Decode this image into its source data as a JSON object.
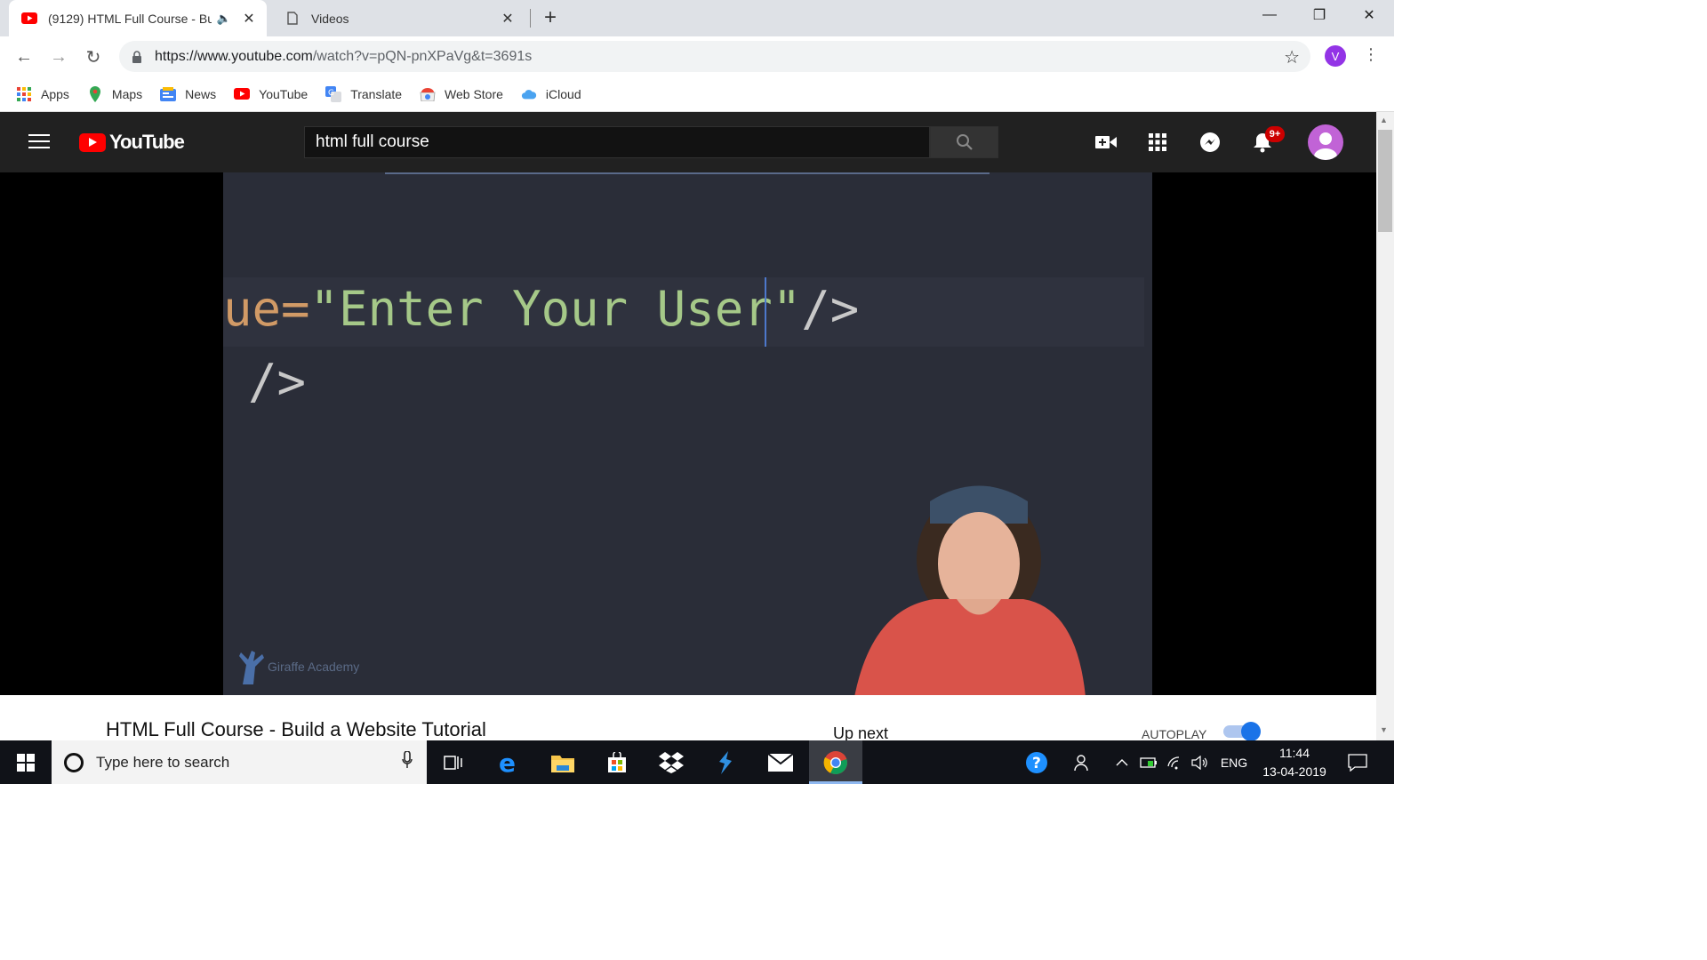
{
  "browser": {
    "tabs": [
      {
        "title": "(9129) HTML Full Course - Bu",
        "active": true,
        "audio": true
      },
      {
        "title": "Videos",
        "active": false
      }
    ],
    "new_tab": "+",
    "window_controls": {
      "minimize": "—",
      "restore": "❐",
      "close": "✕"
    },
    "url_host": "https://www.youtube.com",
    "url_path": "/watch?v=pQN-pnXPaVg&t=3691s",
    "profile_initial": "V",
    "bookmarks": [
      {
        "label": "Apps",
        "icon": "apps-grid-icon"
      },
      {
        "label": "Maps",
        "icon": "maps-icon"
      },
      {
        "label": "News",
        "icon": "news-icon"
      },
      {
        "label": "YouTube",
        "icon": "youtube-icon"
      },
      {
        "label": "Translate",
        "icon": "translate-icon"
      },
      {
        "label": "Web Store",
        "icon": "web-store-icon"
      },
      {
        "label": "iCloud",
        "icon": "icloud-icon"
      }
    ]
  },
  "youtube": {
    "logo_text": "YouTube",
    "search_value": "html full course",
    "notification_count": "9+",
    "video": {
      "code_line1_attr": "ue=",
      "code_line1_string": "\"Enter Your User",
      "code_line1_close_quote": "\"",
      "code_line1_end": "/>",
      "code_line2": "/>",
      "watermark": "Giraffe Academy"
    },
    "video_title": "HTML Full Course - Build a Website Tutorial",
    "up_next": "Up next",
    "autoplay_label": "AUTOPLAY",
    "autoplay_on": true
  },
  "taskbar": {
    "search_placeholder": "Type here to search",
    "language": "ENG",
    "time": "11:44",
    "date": "13-04-2019"
  },
  "colors": {
    "chrome_tabstrip": "#dee1e6",
    "yt_header": "#212121",
    "yt_red": "#ff0000",
    "video_bg": "#2a2d38",
    "code_orange": "#d19a66",
    "code_green": "#a5c888",
    "taskbar": "#101218"
  }
}
